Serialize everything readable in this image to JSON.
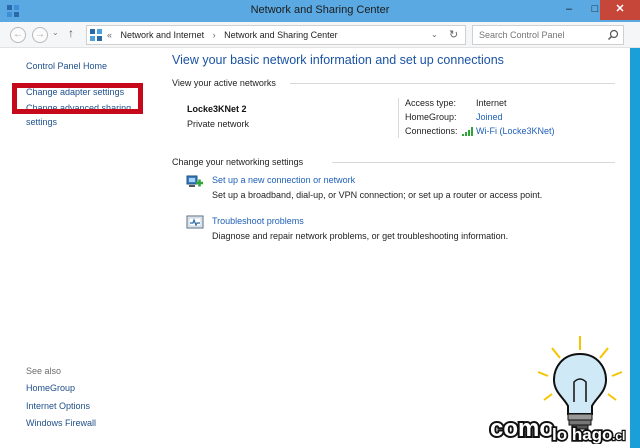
{
  "window": {
    "title": "Network and Sharing Center",
    "minimize": "–",
    "maximize": "□",
    "close": "✕"
  },
  "nav": {
    "back": "←",
    "forward": "→",
    "recent": "⌄",
    "up": "↑",
    "breadcrumb": [
      "«",
      "Network and Internet",
      "›",
      "Network and Sharing Center"
    ],
    "dropdown": "⌄",
    "refresh": "↻",
    "search_placeholder": "Search Control Panel"
  },
  "sidebar": {
    "home": "Control Panel Home",
    "change_adapter": "Change adapter settings",
    "sharing_line1": "Change advanced sharing",
    "sharing_line2": "settings",
    "see_also": "See also",
    "links": [
      "HomeGroup",
      "Internet Options",
      "Windows Firewall"
    ]
  },
  "main": {
    "title": "View your basic network information and set up connections",
    "active_networks_heading": "View your active networks",
    "network": {
      "name": "Locke3KNet  2",
      "type": "Private network"
    },
    "details": {
      "access_type_label": "Access type:",
      "access_type_value": "Internet",
      "homegroup_label": "HomeGroup:",
      "homegroup_value": "Joined",
      "connections_label": "Connections:",
      "connections_value": "Wi-Fi (Locke3KNet)"
    },
    "settings_heading": "Change your networking settings",
    "tasks": [
      {
        "link": "Set up a new connection or network",
        "desc": "Set up a broadband, dial-up, or VPN connection; or set up a router or access point."
      },
      {
        "link": "Troubleshoot problems",
        "desc": "Diagnose and repair network problems, or get troubleshooting information."
      }
    ]
  },
  "watermark": {
    "text_main": "como",
    "text_small": "lo hago",
    "text_tld": ".cl"
  },
  "colors": {
    "titlebar": "#5aa9e2",
    "link": "#1e5fb6",
    "highlight": "#c5081a",
    "close": "#c7463a"
  }
}
